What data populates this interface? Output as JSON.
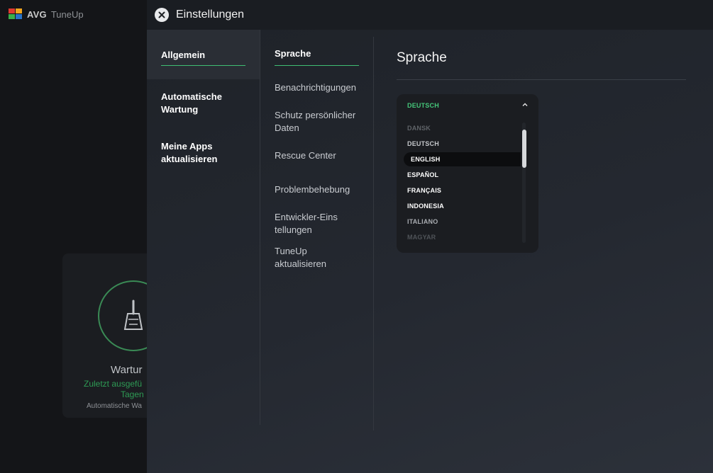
{
  "app": {
    "brand": "AVG",
    "product": "TuneUp",
    "logo_colors": [
      "#e03a2f",
      "#f2a51e",
      "#3bb04a",
      "#2a74c9"
    ]
  },
  "background_card": {
    "title": "Wartur",
    "line1": "Zuletzt ausgefü",
    "line2": "Tagen",
    "line3": "Automatische Wa"
  },
  "settings": {
    "title": "Einstellungen",
    "close_icon": "close-icon",
    "primary_nav": [
      {
        "label": "Allgemein",
        "active": true
      },
      {
        "label": "Automatische Wartung",
        "active": false
      },
      {
        "label": "Meine Apps aktualisieren",
        "active": false
      }
    ],
    "secondary_nav": [
      {
        "label": "Sprache",
        "active": true
      },
      {
        "label": "Benachrichtigungen",
        "active": false
      },
      {
        "label": "Schutz persönlicher Daten",
        "active": false
      },
      {
        "label": "Rescue Center",
        "active": false
      },
      {
        "label": "Problembehebung",
        "active": false
      },
      {
        "label": "Entwickler-Einstellungen",
        "active": false
      },
      {
        "label": "TuneUp aktualisieren",
        "active": false
      }
    ],
    "content": {
      "title": "Sprache",
      "language_select": {
        "selected": "DEUTSCH",
        "options": [
          "DANSK",
          "DEUTSCH",
          "ENGLISH",
          "ESPAÑOL",
          "FRANÇAIS",
          "INDONESIA",
          "ITALIANO",
          "MAGYAR"
        ],
        "highlighted": "ENGLISH"
      }
    }
  },
  "colors": {
    "accent_green": "#3fbf73",
    "selected_text_green": "#45c77a"
  }
}
